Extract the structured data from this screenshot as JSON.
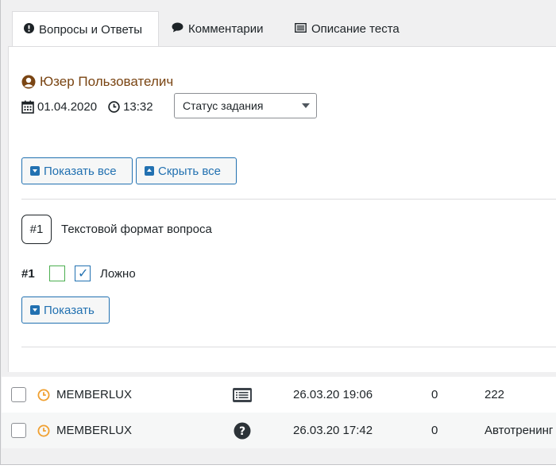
{
  "tabs": [
    {
      "label": "Вопросы и Ответы",
      "icon": "info-icon"
    },
    {
      "label": "Комментарии",
      "icon": "comment-icon"
    },
    {
      "label": "Описание теста",
      "icon": "list-icon"
    }
  ],
  "user": {
    "name": "Юзер Пользователич",
    "icon": "user-icon"
  },
  "meta": {
    "date": "01.04.2020",
    "time": "13:32"
  },
  "status_select": {
    "value": "Статус задания"
  },
  "buttons": {
    "show_all": "Показать все",
    "hide_all": "Скрыть все",
    "show": "Показать"
  },
  "question": {
    "number": "#1",
    "text": "Текстовой формат вопроса"
  },
  "answer": {
    "number": "#1",
    "label": "Ложно",
    "checked": true
  },
  "rows": [
    {
      "name": "MEMBERLUX",
      "type_icon": "list-icon",
      "date": "26.03.20 19:06",
      "count": "0",
      "last": "222"
    },
    {
      "name": "MEMBERLUX",
      "type_icon": "question-icon",
      "date": "26.03.20 17:42",
      "count": "0",
      "last": "Автотренинг"
    }
  ],
  "colors": {
    "accent": "#2271b1",
    "user": "#7a4513",
    "clock": "#f0a030"
  }
}
